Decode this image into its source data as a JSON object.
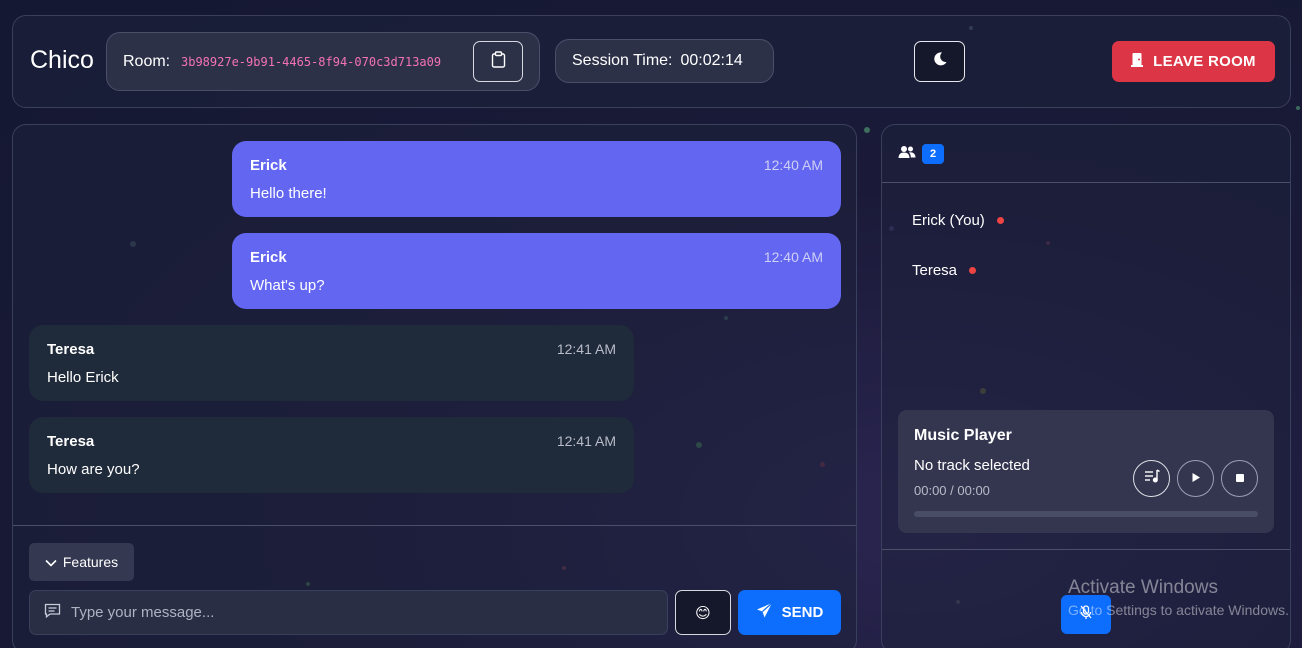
{
  "header": {
    "brand": "Chico",
    "room_label": "Room:",
    "room_id": "3b98927e-9b91-4465-8f94-070c3d713a09",
    "session_label": "Session Time:",
    "session_time": "00:02:14",
    "leave_label": "LEAVE ROOM"
  },
  "chat": {
    "messages": [
      {
        "sender": "Erick",
        "time": "12:40 AM",
        "text": "Hello there!",
        "own": true
      },
      {
        "sender": "Erick",
        "time": "12:40 AM",
        "text": "What's up?",
        "own": true
      },
      {
        "sender": "Teresa",
        "time": "12:41 AM",
        "text": "Hello Erick",
        "own": false
      },
      {
        "sender": "Teresa",
        "time": "12:41 AM",
        "text": "How are you?",
        "own": false
      }
    ],
    "features_label": "Features",
    "input_placeholder": "Type your message...",
    "emoji": "😊",
    "send_label": "SEND"
  },
  "users": {
    "count": "2",
    "list": [
      {
        "name": "Erick (You)"
      },
      {
        "name": "Teresa"
      }
    ]
  },
  "music": {
    "title": "Music Player",
    "track": "No track selected",
    "time": "00:00 / 00:00",
    "progress": 0
  },
  "watermark": {
    "line1": "Activate Windows",
    "line2": "Go to Settings to activate Windows."
  },
  "colors": {
    "accent": "#6366f1",
    "primary": "#0d6efd",
    "danger": "#dc3545",
    "room_id": "#f472b6",
    "status": "#ef4444"
  },
  "icons": [
    "clipboard-icon",
    "moon-icon",
    "door-icon",
    "users-icon",
    "chevron-down-icon",
    "message-icon",
    "send-icon",
    "playlist-icon",
    "play-icon",
    "stop-icon",
    "mic-off-icon"
  ]
}
